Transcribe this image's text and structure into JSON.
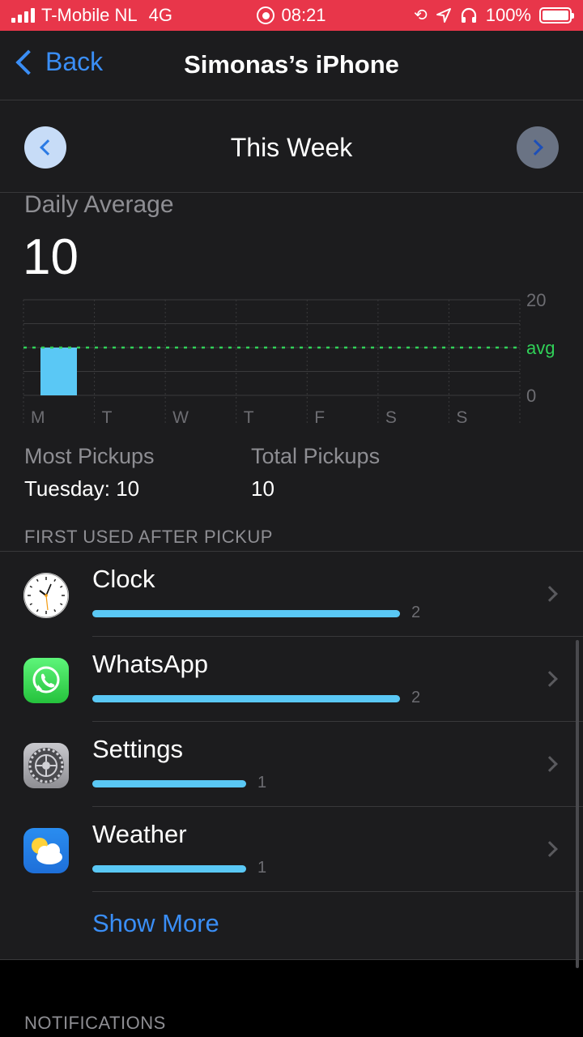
{
  "status_bar": {
    "carrier": "T-Mobile NL",
    "network": "4G",
    "time": "08:21",
    "battery": "100%",
    "icons": [
      "signal-icon",
      "screen-recording-icon",
      "orientation-lock-icon",
      "location-icon",
      "headphones-icon",
      "battery-icon"
    ]
  },
  "nav": {
    "back_label": "Back",
    "title": "Simonas’s iPhone"
  },
  "week": {
    "title": "This Week"
  },
  "daily_average": {
    "label": "Daily Average",
    "value": "10"
  },
  "chart_data": {
    "type": "bar",
    "categories": [
      "M",
      "T",
      "W",
      "T",
      "F",
      "S",
      "S"
    ],
    "values": [
      10,
      0,
      0,
      0,
      0,
      0,
      0
    ],
    "ylim": [
      0,
      20
    ],
    "y_ticks": [
      "20",
      "0"
    ],
    "average": 10,
    "average_label": "avg",
    "grid": true,
    "colors": {
      "bar": "#5ac8f5",
      "avg_line": "#30d158"
    }
  },
  "stats": {
    "most_label": "Most Pickups",
    "most_value": "Tuesday: 10",
    "total_label": "Total Pickups",
    "total_value": "10"
  },
  "first_used": {
    "header": "FIRST USED AFTER PICKUP",
    "apps": [
      {
        "name": "Clock",
        "count": "2",
        "fraction": 1.0,
        "icon": "clock-app-icon"
      },
      {
        "name": "WhatsApp",
        "count": "2",
        "fraction": 1.0,
        "icon": "whatsapp-app-icon"
      },
      {
        "name": "Settings",
        "count": "1",
        "fraction": 0.5,
        "icon": "settings-app-icon"
      },
      {
        "name": "Weather",
        "count": "1",
        "fraction": 0.5,
        "icon": "weather-app-icon"
      }
    ],
    "show_more": "Show More"
  },
  "notifications": {
    "header": "NOTIFICATIONS"
  }
}
